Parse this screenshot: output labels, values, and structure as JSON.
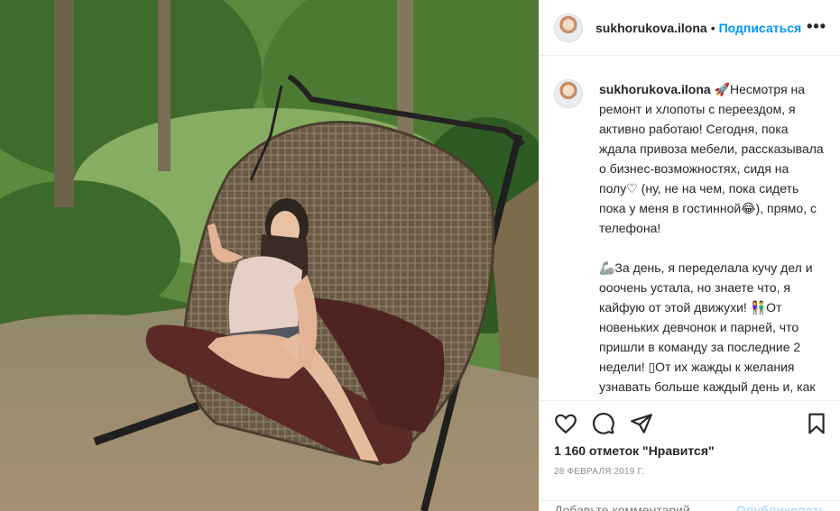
{
  "post": {
    "username": "sukhorukova.ilona",
    "follow_label": "Подписаться",
    "separator": "•",
    "more_label": "•••",
    "caption_username": "sukhorukova.ilona",
    "caption_text": " 🚀Несмотря на ремонт и хлопоты с переездом, я активно работаю! Сегодня, пока ждала привоза мебели, рассказывала о бизнес-возможностях, сидя на полу♡ (ну, не на чем, пока сидеть пока у меня в гостинной😂), прямо, с телефона!\n\n🦾За день, я переделала кучу дел и ооочень устала, но знаете что, я кайфую от этой движухи! 👫От новеньких девчонок и парней, что пришли в команду за последние 2 недели! ▯От их жажды к желания узнавать больше каждый день и, как следствие, неукратимого стремления действовать не останавливаясь!\n\n▯Если ты в поисках способа",
    "likes_text": "1 160 отметок \"Нравится\"",
    "date_text": "28 февраля 2019 г.",
    "comment_placeholder": "Добавьте комментарий...",
    "publish_label": "Опубликовать"
  },
  "icons": {
    "like": "heart-icon",
    "comment": "comment-icon",
    "share": "share-icon",
    "save": "bookmark-icon",
    "more": "more-icon"
  },
  "colors": {
    "link_blue": "#0095f6",
    "text": "#262626",
    "muted": "#8e8e8e",
    "border": "#efefef"
  }
}
